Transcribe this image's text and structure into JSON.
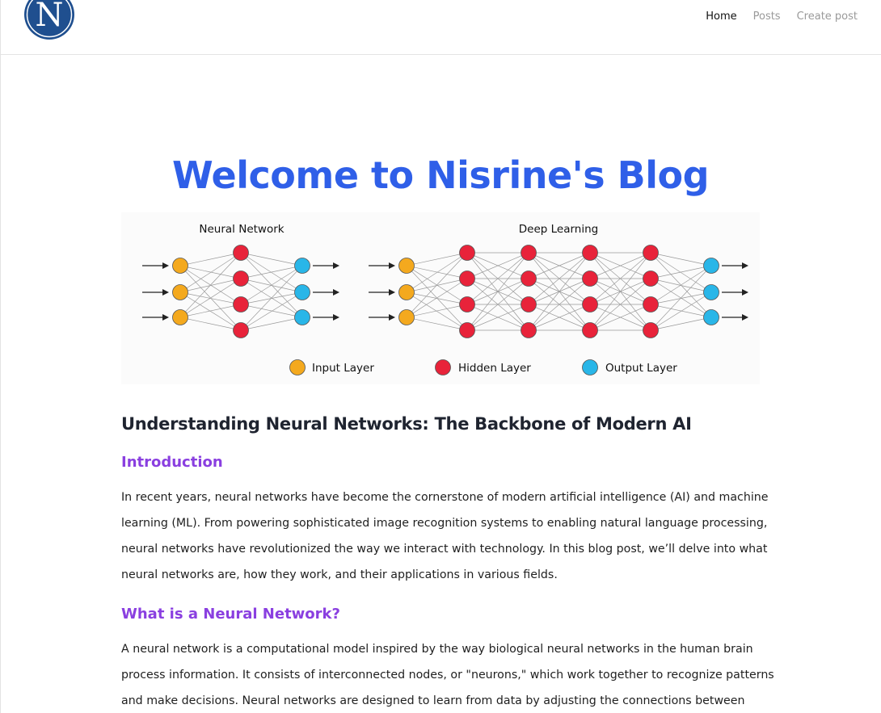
{
  "nav": {
    "logo_letter": "N",
    "links": [
      {
        "label": "Home",
        "active": true
      },
      {
        "label": "Posts",
        "active": false
      },
      {
        "label": "Create post",
        "active": false
      }
    ]
  },
  "hero": {
    "title": "Welcome to Nisrine's Blog"
  },
  "figure": {
    "left_title": "Neural Network",
    "right_title": "Deep Learning",
    "legend": {
      "input": "Input Layer",
      "hidden": "Hidden Layer",
      "output": "Output Layer"
    },
    "colors": {
      "input": "#f4a91e",
      "hidden": "#e8233a",
      "output": "#29b6e8"
    }
  },
  "post": {
    "title": "Understanding Neural Networks: The Backbone of Modern AI",
    "intro_heading": "Introduction",
    "intro_lines": [
      "In recent years, neural networks have become the cornerstone of modern artificial intelligence (AI) and machine",
      "learning (ML). From powering sophisticated image recognition systems to enabling natural language processing,",
      "neural networks have revolutionized the way we interact with technology. In this blog post, we’ll delve into what",
      "neural networks are, how they work, and their applications in various fields."
    ],
    "what_heading": "What is a Neural Network?",
    "what_lines": [
      "A neural network is a computational model inspired by the way biological neural networks in the human brain",
      "process information. It consists of interconnected nodes, or \"neurons,\" which work together to recognize patterns",
      "and make decisions. Neural networks are designed to learn from data by adjusting the connections between"
    ]
  }
}
